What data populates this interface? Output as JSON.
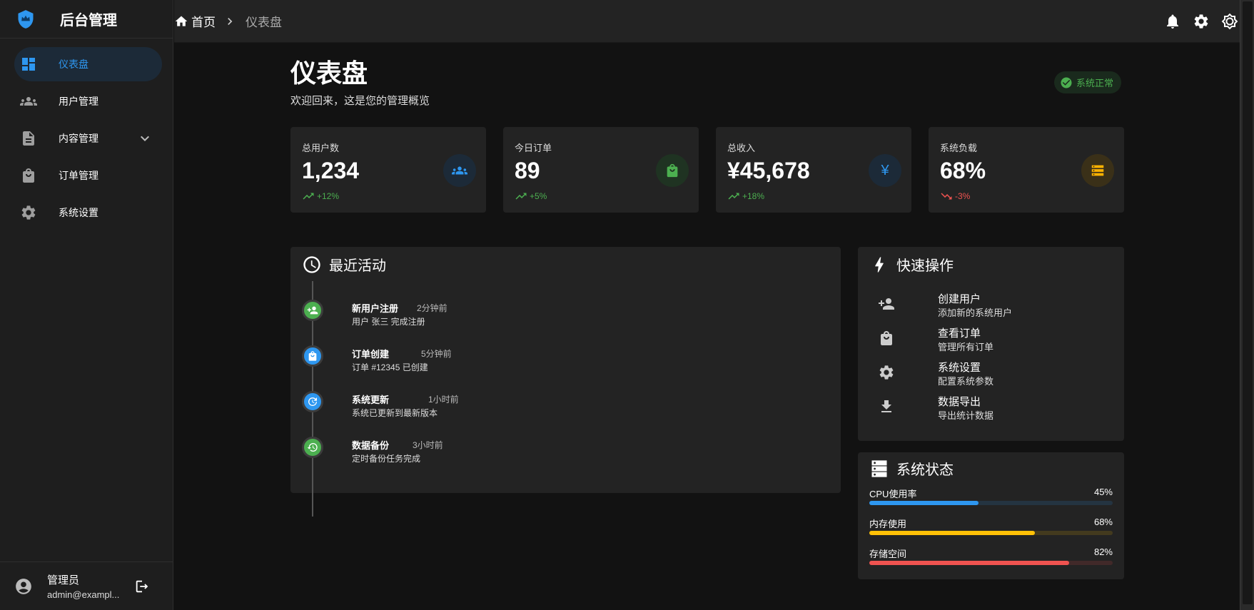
{
  "sidebar": {
    "brand": "后台管理",
    "items": [
      {
        "label": "仪表盘",
        "icon": "dashboard-icon"
      },
      {
        "label": "用户管理",
        "icon": "people-icon"
      },
      {
        "label": "内容管理",
        "icon": "document-icon"
      },
      {
        "label": "订单管理",
        "icon": "shopping-bag-icon"
      },
      {
        "label": "系统设置",
        "icon": "gear-icon"
      }
    ],
    "user": {
      "name": "管理员",
      "email": "admin@exampl..."
    }
  },
  "topbar": {
    "breadcrumb_home": "首页",
    "breadcrumb_current": "仪表盘"
  },
  "page": {
    "title": "仪表盘",
    "subtitle": "欢迎回来，这是您的管理概览",
    "status": "系统正常"
  },
  "stats": [
    {
      "label": "总用户数",
      "value": "1,234",
      "change": "+12%",
      "trend": "up",
      "icon": "people-icon",
      "color": "#2e97f0"
    },
    {
      "label": "今日订单",
      "value": "89",
      "change": "+5%",
      "trend": "up",
      "icon": "shopping-bag-icon",
      "color": "#4caf50"
    },
    {
      "label": "总收入",
      "value": "¥45,678",
      "change": "+18%",
      "trend": "up",
      "icon": "yen-icon",
      "glyph": "¥",
      "color": "#2e97f0"
    },
    {
      "label": "系统负载",
      "value": "68%",
      "change": "-3%",
      "trend": "down",
      "icon": "server-icon",
      "color": "#ffb300"
    }
  ],
  "activity": {
    "title": "最近活动",
    "items": [
      {
        "title": "新用户注册",
        "time": "2分钟前",
        "desc": "用户 张三 完成注册",
        "icon": "person-add-icon",
        "color": "#4caf50"
      },
      {
        "title": "订单创建",
        "time": "5分钟前",
        "desc": "订单 #12345 已创建",
        "icon": "shopping-bag-icon",
        "color": "#2e97f0"
      },
      {
        "title": "系统更新",
        "time": "1小时前",
        "desc": "系统已更新到最新版本",
        "icon": "update-icon",
        "color": "#2e97f0"
      },
      {
        "title": "数据备份",
        "time": "3小时前",
        "desc": "定时备份任务完成",
        "icon": "backup-icon",
        "color": "#4caf50"
      }
    ]
  },
  "quick_actions": {
    "title": "快速操作",
    "items": [
      {
        "title": "创建用户",
        "desc": "添加新的系统用户",
        "icon": "person-add-icon"
      },
      {
        "title": "查看订单",
        "desc": "管理所有订单",
        "icon": "shopping-bag-icon"
      },
      {
        "title": "系统设置",
        "desc": "配置系统参数",
        "icon": "gear-icon"
      },
      {
        "title": "数据导出",
        "desc": "导出统计数据",
        "icon": "download-icon"
      }
    ]
  },
  "system_status": {
    "title": "系统状态",
    "items": [
      {
        "name": "CPU使用率",
        "percent_text": "45%",
        "value": 0.45,
        "color": "#2e97f0"
      },
      {
        "name": "内存使用",
        "percent_text": "68%",
        "value": 0.68,
        "color": "#ffc107"
      },
      {
        "name": "存储空间",
        "percent_text": "82%",
        "value": 0.82,
        "color": "#ef5350"
      }
    ]
  }
}
